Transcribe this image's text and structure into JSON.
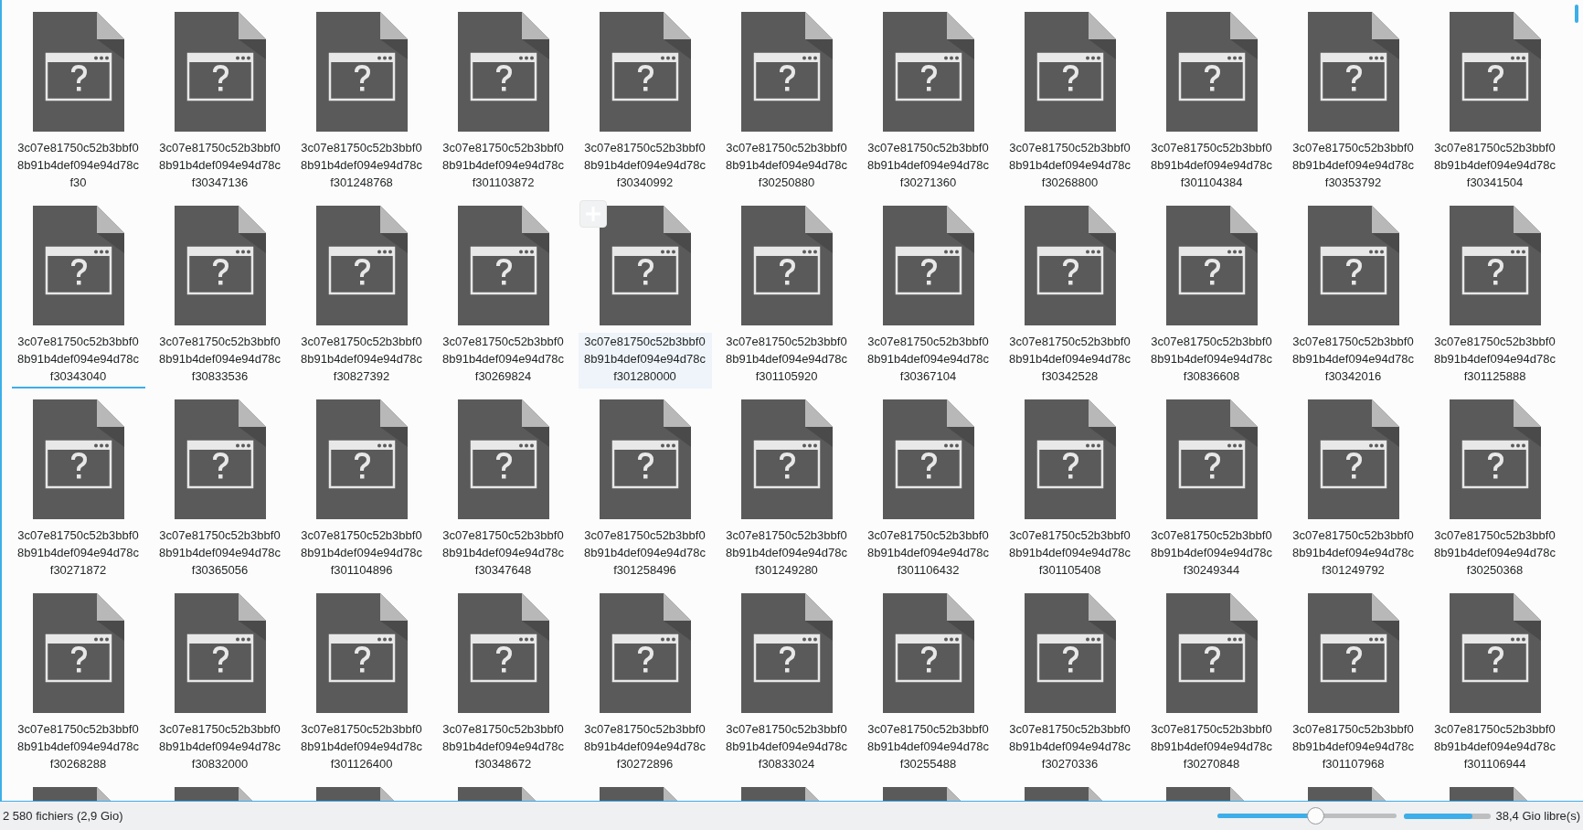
{
  "files": [
    {
      "kind": "file",
      "name": "3c07e81750c52b3bbf08b91b4def094e94d78cf30",
      "focused": false,
      "hovered": false
    },
    {
      "kind": "file",
      "name": "3c07e81750c52b3bbf08b91b4def094e94d78cf30347136",
      "focused": false,
      "hovered": false
    },
    {
      "kind": "file",
      "name": "3c07e81750c52b3bbf08b91b4def094e94d78cf301248768",
      "focused": false,
      "hovered": false
    },
    {
      "kind": "file",
      "name": "3c07e81750c52b3bbf08b91b4def094e94d78cf301103872",
      "focused": false,
      "hovered": false
    },
    {
      "kind": "file",
      "name": "3c07e81750c52b3bbf08b91b4def094e94d78cf30340992",
      "focused": false,
      "hovered": false
    },
    {
      "kind": "file",
      "name": "3c07e81750c52b3bbf08b91b4def094e94d78cf30250880",
      "focused": false,
      "hovered": false
    },
    {
      "kind": "file",
      "name": "3c07e81750c52b3bbf08b91b4def094e94d78cf30271360",
      "focused": false,
      "hovered": false
    },
    {
      "kind": "file",
      "name": "3c07e81750c52b3bbf08b91b4def094e94d78cf30268800",
      "focused": false,
      "hovered": false
    },
    {
      "kind": "file",
      "name": "3c07e81750c52b3bbf08b91b4def094e94d78cf301104384",
      "focused": false,
      "hovered": false
    },
    {
      "kind": "file",
      "name": "3c07e81750c52b3bbf08b91b4def094e94d78cf30353792",
      "focused": false,
      "hovered": false
    },
    {
      "kind": "file",
      "name": "3c07e81750c52b3bbf08b91b4def094e94d78cf30341504",
      "focused": false,
      "hovered": false
    },
    {
      "kind": "file",
      "name": "3c07e81750c52b3bbf08b91b4def094e94d78cf30343040",
      "focused": true,
      "hovered": false
    },
    {
      "kind": "file",
      "name": "3c07e81750c52b3bbf08b91b4def094e94d78cf30833536",
      "focused": false,
      "hovered": false
    },
    {
      "kind": "file",
      "name": "3c07e81750c52b3bbf08b91b4def094e94d78cf30827392",
      "focused": false,
      "hovered": false
    },
    {
      "kind": "file",
      "name": "3c07e81750c52b3bbf08b91b4def094e94d78cf30269824",
      "focused": false,
      "hovered": false
    },
    {
      "kind": "file",
      "name": "3c07e81750c52b3bbf08b91b4def094e94d78cf301280000",
      "focused": false,
      "hovered": true
    },
    {
      "kind": "file",
      "name": "3c07e81750c52b3bbf08b91b4def094e94d78cf301105920",
      "focused": false,
      "hovered": false
    },
    {
      "kind": "file",
      "name": "3c07e81750c52b3bbf08b91b4def094e94d78cf30367104",
      "focused": false,
      "hovered": false
    },
    {
      "kind": "file",
      "name": "3c07e81750c52b3bbf08b91b4def094e94d78cf30342528",
      "focused": false,
      "hovered": false
    },
    {
      "kind": "file",
      "name": "3c07e81750c52b3bbf08b91b4def094e94d78cf30836608",
      "focused": false,
      "hovered": false
    },
    {
      "kind": "file",
      "name": "3c07e81750c52b3bbf08b91b4def094e94d78cf30342016",
      "focused": false,
      "hovered": false
    },
    {
      "kind": "file",
      "name": "3c07e81750c52b3bbf08b91b4def094e94d78cf301125888",
      "focused": false,
      "hovered": false
    },
    {
      "kind": "file",
      "name": "3c07e81750c52b3bbf08b91b4def094e94d78cf30271872",
      "focused": false,
      "hovered": false
    },
    {
      "kind": "file",
      "name": "3c07e81750c52b3bbf08b91b4def094e94d78cf30365056",
      "focused": false,
      "hovered": false
    },
    {
      "kind": "file",
      "name": "3c07e81750c52b3bbf08b91b4def094e94d78cf301104896",
      "focused": false,
      "hovered": false
    },
    {
      "kind": "file",
      "name": "3c07e81750c52b3bbf08b91b4def094e94d78cf30347648",
      "focused": false,
      "hovered": false
    },
    {
      "kind": "file",
      "name": "3c07e81750c52b3bbf08b91b4def094e94d78cf301258496",
      "focused": false,
      "hovered": false
    },
    {
      "kind": "file",
      "name": "3c07e81750c52b3bbf08b91b4def094e94d78cf301249280",
      "focused": false,
      "hovered": false
    },
    {
      "kind": "file",
      "name": "3c07e81750c52b3bbf08b91b4def094e94d78cf301106432",
      "focused": false,
      "hovered": false
    },
    {
      "kind": "file",
      "name": "3c07e81750c52b3bbf08b91b4def094e94d78cf301105408",
      "focused": false,
      "hovered": false
    },
    {
      "kind": "file",
      "name": "3c07e81750c52b3bbf08b91b4def094e94d78cf30249344",
      "focused": false,
      "hovered": false
    },
    {
      "kind": "file",
      "name": "3c07e81750c52b3bbf08b91b4def094e94d78cf301249792",
      "focused": false,
      "hovered": false
    },
    {
      "kind": "file",
      "name": "3c07e81750c52b3bbf08b91b4def094e94d78cf30250368",
      "focused": false,
      "hovered": false
    },
    {
      "kind": "file",
      "name": "3c07e81750c52b3bbf08b91b4def094e94d78cf30268288",
      "focused": false,
      "hovered": false
    },
    {
      "kind": "file",
      "name": "3c07e81750c52b3bbf08b91b4def094e94d78cf30832000",
      "focused": false,
      "hovered": false
    },
    {
      "kind": "file",
      "name": "3c07e81750c52b3bbf08b91b4def094e94d78cf301126400",
      "focused": false,
      "hovered": false
    },
    {
      "kind": "file",
      "name": "3c07e81750c52b3bbf08b91b4def094e94d78cf30348672",
      "focused": false,
      "hovered": false
    },
    {
      "kind": "file",
      "name": "3c07e81750c52b3bbf08b91b4def094e94d78cf30272896",
      "focused": false,
      "hovered": false
    },
    {
      "kind": "file",
      "name": "3c07e81750c52b3bbf08b91b4def094e94d78cf30833024",
      "focused": false,
      "hovered": false
    },
    {
      "kind": "file",
      "name": "3c07e81750c52b3bbf08b91b4def094e94d78cf30255488",
      "focused": false,
      "hovered": false
    },
    {
      "kind": "file",
      "name": "3c07e81750c52b3bbf08b91b4def094e94d78cf30270336",
      "focused": false,
      "hovered": false
    },
    {
      "kind": "file",
      "name": "3c07e81750c52b3bbf08b91b4def094e94d78cf30270848",
      "focused": false,
      "hovered": false
    },
    {
      "kind": "file",
      "name": "3c07e81750c52b3bbf08b91b4def094e94d78cf301107968",
      "focused": false,
      "hovered": false
    },
    {
      "kind": "file",
      "name": "3c07e81750c52b3bbf08b91b4def094e94d78cf301106944",
      "focused": false,
      "hovered": false
    },
    {
      "kind": "partial"
    },
    {
      "kind": "partial"
    },
    {
      "kind": "partial"
    },
    {
      "kind": "partial"
    },
    {
      "kind": "partial"
    },
    {
      "kind": "partial"
    },
    {
      "kind": "partial"
    },
    {
      "kind": "partial"
    },
    {
      "kind": "partial"
    },
    {
      "kind": "partial"
    },
    {
      "kind": "partial"
    }
  ],
  "status_bar": {
    "summary": "2 580 fichiers (2,9 Gio)",
    "zoom": {
      "level": 0.55
    },
    "free_space": {
      "level": 0.79
    },
    "free_text": "38,4 Gio libre(s)"
  }
}
